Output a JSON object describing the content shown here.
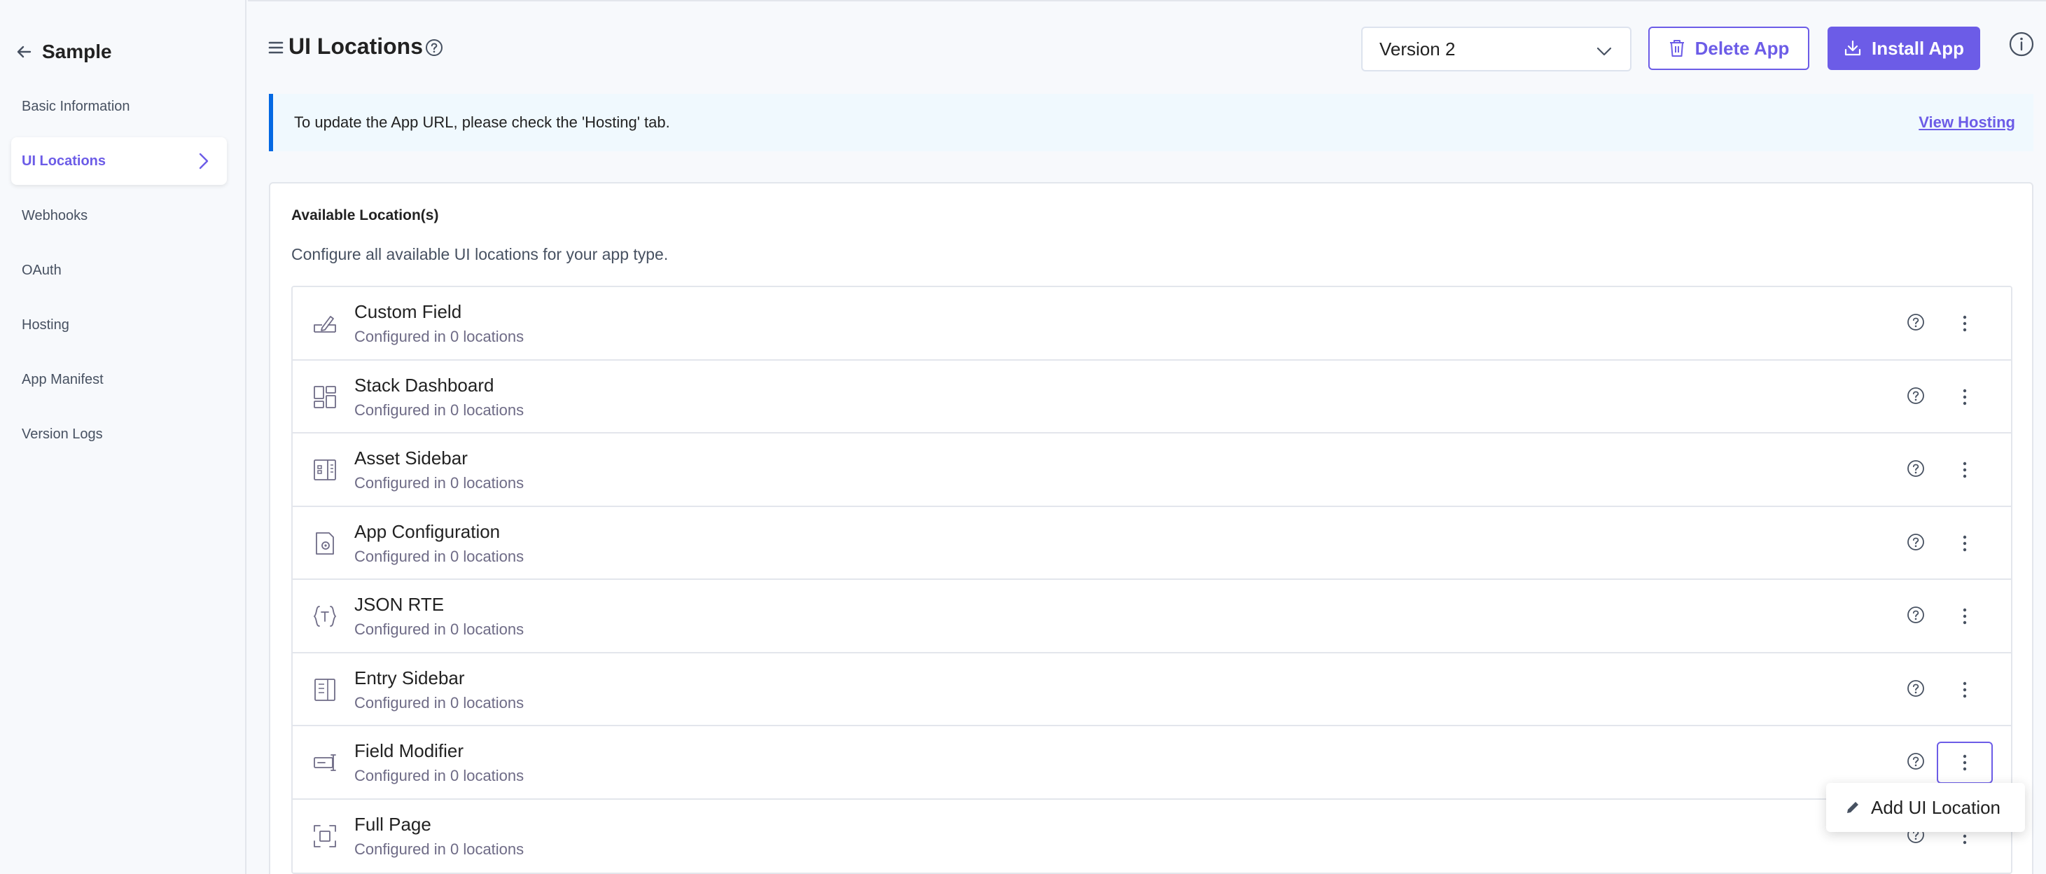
{
  "sidebar": {
    "app_name": "Sample",
    "items": [
      {
        "label": "Basic Information",
        "active": false
      },
      {
        "label": "UI Locations",
        "active": true
      },
      {
        "label": "Webhooks",
        "active": false
      },
      {
        "label": "OAuth",
        "active": false
      },
      {
        "label": "Hosting",
        "active": false
      },
      {
        "label": "App Manifest",
        "active": false
      },
      {
        "label": "Version Logs",
        "active": false
      }
    ]
  },
  "header": {
    "title": "UI Locations",
    "version_selected": "Version 2",
    "delete_label": "Delete App",
    "install_label": "Install App"
  },
  "notice": {
    "text": "To update the App URL, please check the 'Hosting' tab.",
    "link": "View Hosting"
  },
  "card": {
    "title": "Available Location(s)",
    "description": "Configure all available UI locations for your app type."
  },
  "locations": [
    {
      "name": "Custom Field",
      "status": "Configured in 0 locations",
      "icon": "custom-field-icon"
    },
    {
      "name": "Stack Dashboard",
      "status": "Configured in 0 locations",
      "icon": "dashboard-icon"
    },
    {
      "name": "Asset Sidebar",
      "status": "Configured in 0 locations",
      "icon": "asset-sidebar-icon"
    },
    {
      "name": "App Configuration",
      "status": "Configured in 0 locations",
      "icon": "app-config-icon"
    },
    {
      "name": "JSON RTE",
      "status": "Configured in 0 locations",
      "icon": "json-rte-icon"
    },
    {
      "name": "Entry Sidebar",
      "status": "Configured in 0 locations",
      "icon": "entry-sidebar-icon"
    },
    {
      "name": "Field Modifier",
      "status": "Configured in 0 locations",
      "icon": "field-modifier-icon"
    },
    {
      "name": "Full Page",
      "status": "Configured in 0 locations",
      "icon": "full-page-icon"
    }
  ],
  "dropdown": {
    "label": "Add UI Location"
  },
  "colors": {
    "accent": "#6c5ce7",
    "notice_border": "#0469e3",
    "notice_bg": "#f0f9fe"
  }
}
